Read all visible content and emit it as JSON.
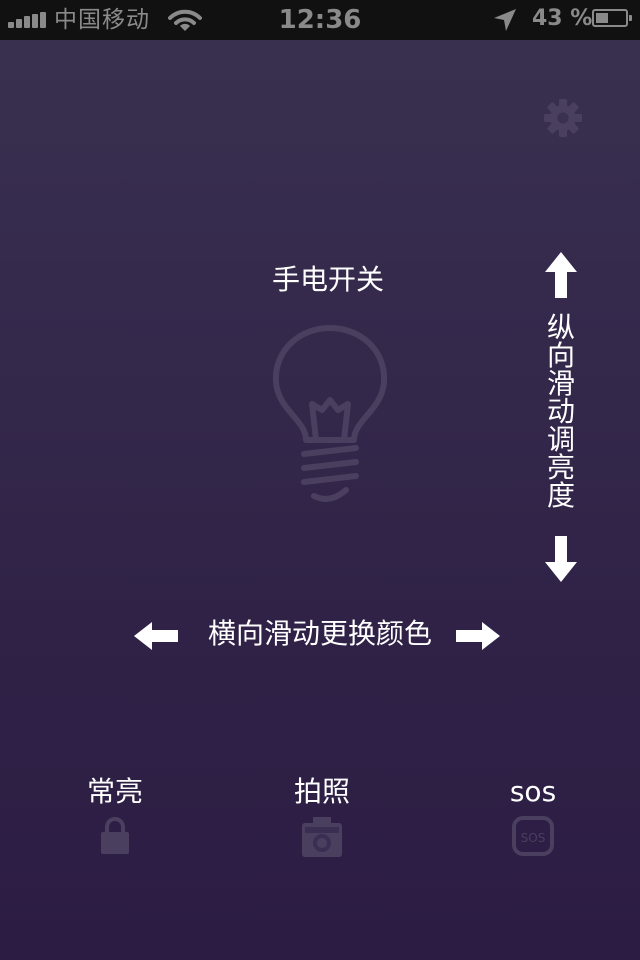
{
  "status_bar": {
    "carrier": "中国移动",
    "time": "12:36",
    "battery": "43 %",
    "signal_icon": "signal-bars-icon",
    "wifi_icon": "wifi-icon",
    "location_icon": "location-arrow-icon",
    "battery_level": 0.43
  },
  "header": {
    "settings_icon": "gear-icon"
  },
  "main": {
    "toggle_label": "手电开关",
    "bulb_icon": "light-bulb-icon",
    "vertical_hint": "纵向滑动调亮度",
    "horizontal_hint": "横向滑动更换颜色"
  },
  "modes": [
    {
      "label": "常亮",
      "icon": "lock-icon"
    },
    {
      "label": "拍照",
      "icon": "camera-icon"
    },
    {
      "label": "sos",
      "icon": "sos-icon"
    }
  ],
  "colors": {
    "background_top": "#3a3150",
    "background_bottom": "#2c1c44",
    "status_bar": "#111111",
    "status_text": "#8a8a8a",
    "text": "#ffffff",
    "muted_icon": "#4a3f5e"
  }
}
